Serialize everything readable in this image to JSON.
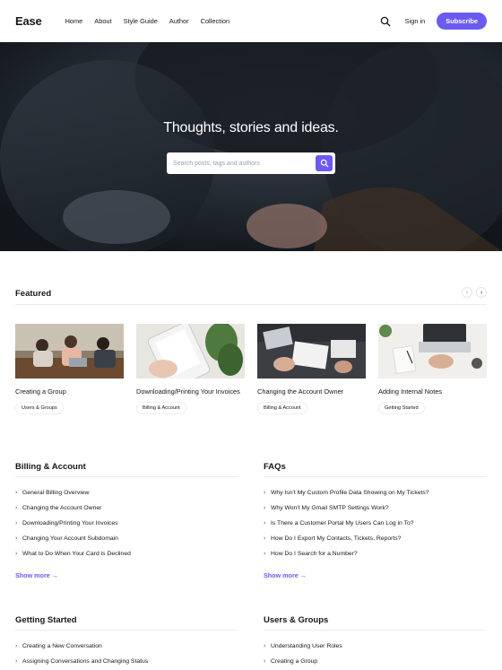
{
  "header": {
    "logo": "Ease",
    "nav": [
      "Home",
      "About",
      "Style Guide",
      "Author",
      "Collection"
    ],
    "signin": "Sign in",
    "subscribe": "Subscribe"
  },
  "hero": {
    "title": "Thoughts, stories and ideas.",
    "search_placeholder": "Search posts, tags and authors"
  },
  "featured": {
    "title": "Featured",
    "cards": [
      {
        "title": "Creating a Group",
        "tag": "Users & Groups"
      },
      {
        "title": "Downloading/Printing Your Invoices",
        "tag": "Billing & Account"
      },
      {
        "title": "Changing the Account Owner",
        "tag": "Billing & Account"
      },
      {
        "title": "Adding Internal Notes",
        "tag": "Getting Started"
      }
    ]
  },
  "sections": {
    "billing": {
      "title": "Billing & Account",
      "items": [
        "General Billing Overview",
        "Changing the Account Owner",
        "Downloading/Printing Your Invoices",
        "Changing Your Account Subdomain",
        "What to Do When Your Card is Declined"
      ],
      "show_more": "Show more →"
    },
    "faqs": {
      "title": "FAQs",
      "items": [
        "Why Isn't My Custom Profile Data Showing on My Tickets?",
        "Why Won't My Gmail SMTP Settings Work?",
        "Is There a Customer Portal My Users Can Log in To?",
        "How Do I Export My Contacts, Tickets, Reports?",
        "How Do I Search for a Number?"
      ],
      "show_more": "Show more →"
    },
    "getting_started": {
      "title": "Getting Started",
      "items": [
        "Creating a New Conversation",
        "Assigning Conversations and Changing Status"
      ]
    },
    "users_groups": {
      "title": "Users & Groups",
      "items": [
        "Understanding User Roles",
        "Creating a Group"
      ]
    }
  },
  "colors": {
    "accent": "#6a5af0",
    "text": "#15171a"
  }
}
